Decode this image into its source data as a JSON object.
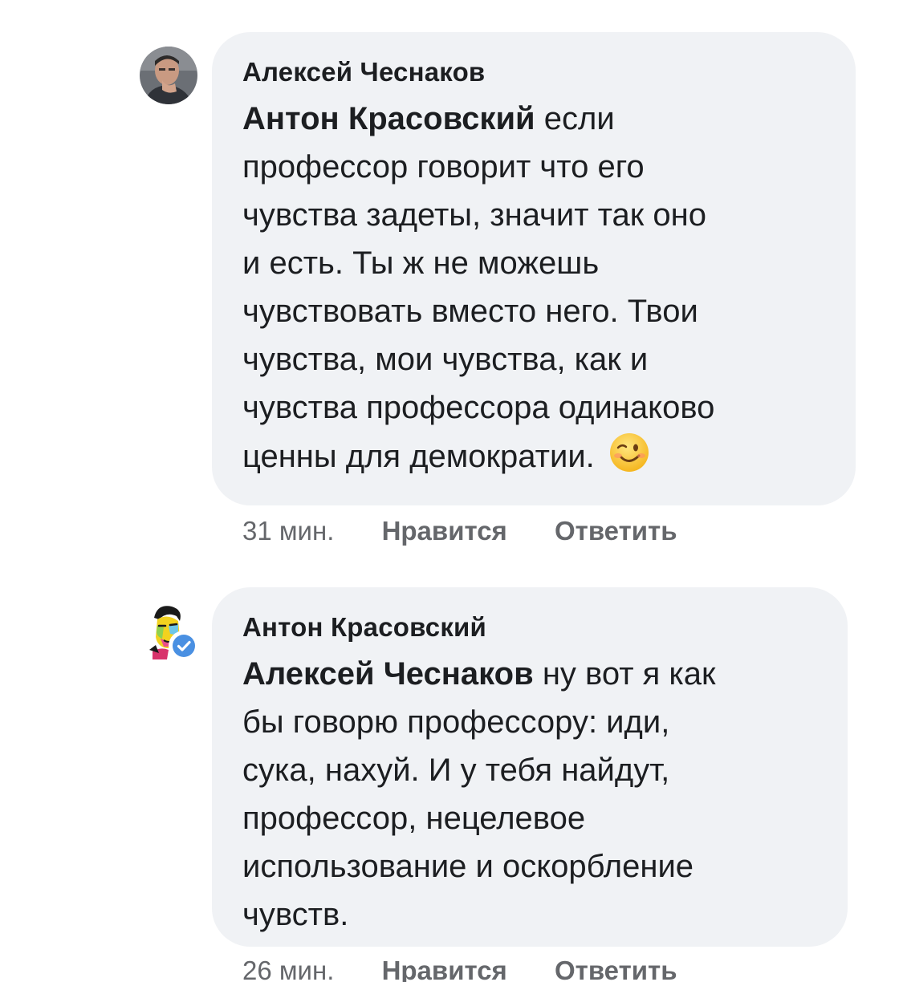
{
  "comments": [
    {
      "author": "Алексей Чеснаков",
      "mention": "Антон Красовский",
      "text_lines": [
        " если",
        "профессор говорит что его",
        "чувства задеты, значит так оно",
        "и есть. Ты ж не можешь",
        "чувствовать вместо него. Твои",
        "чувства, мои чувства, как и",
        "чувства профессора одинаково",
        "ценны для демократии."
      ],
      "emoji": "wink-emoji",
      "time": "31 мин.",
      "like_label": "Нравится",
      "reply_label": "Ответить"
    },
    {
      "author": "Антон Красовский",
      "mention": "Алексей Чеснаков",
      "text_lines": [
        " ну вот я как",
        "бы говорю профессору: иди,",
        "сука, нахуй. И у тебя найдут,",
        "профессор, нецелевое",
        "использование и оскорбление",
        "чувств."
      ],
      "verified": true,
      "time": "26 мин.",
      "like_label": "Нравится",
      "reply_label": "Ответить"
    }
  ],
  "colors": {
    "bubble": "#f0f2f5",
    "text": "#1c1e21",
    "meta": "#65676b",
    "verified": "#4a90e2"
  }
}
